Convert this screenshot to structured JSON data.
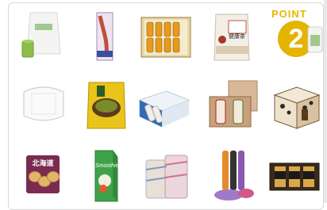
{
  "point_label": "POINT",
  "point_number": "2",
  "hokkaido_text": "北海道",
  "kenko_text": "健康茶",
  "smoothie_text": "Smoothie",
  "icons": {
    "tile_1": "green-drink-powder-bag",
    "tile_2": "dried-fish-snack-pack",
    "tile_3": "juice-bottle-gift-box",
    "tile_4": "health-tea-pouch",
    "tile_6": "white-bathroom-scale",
    "tile_7": "miso-soup-pack",
    "tile_8": "bottle-gift-box-blue",
    "tile_9": "two-bottle-gift-box",
    "tile_10": "leaf-pattern-gift-box",
    "tile_11": "hokkaido-cookies-bag",
    "tile_12": "smoothie-carton",
    "tile_13": "rolled-towels",
    "tile_14": "yoga-mats",
    "tile_15": "three-jar-gift-set"
  },
  "colors": {
    "accent_yellow": "#e3b400",
    "border": "#d9d9d9"
  }
}
